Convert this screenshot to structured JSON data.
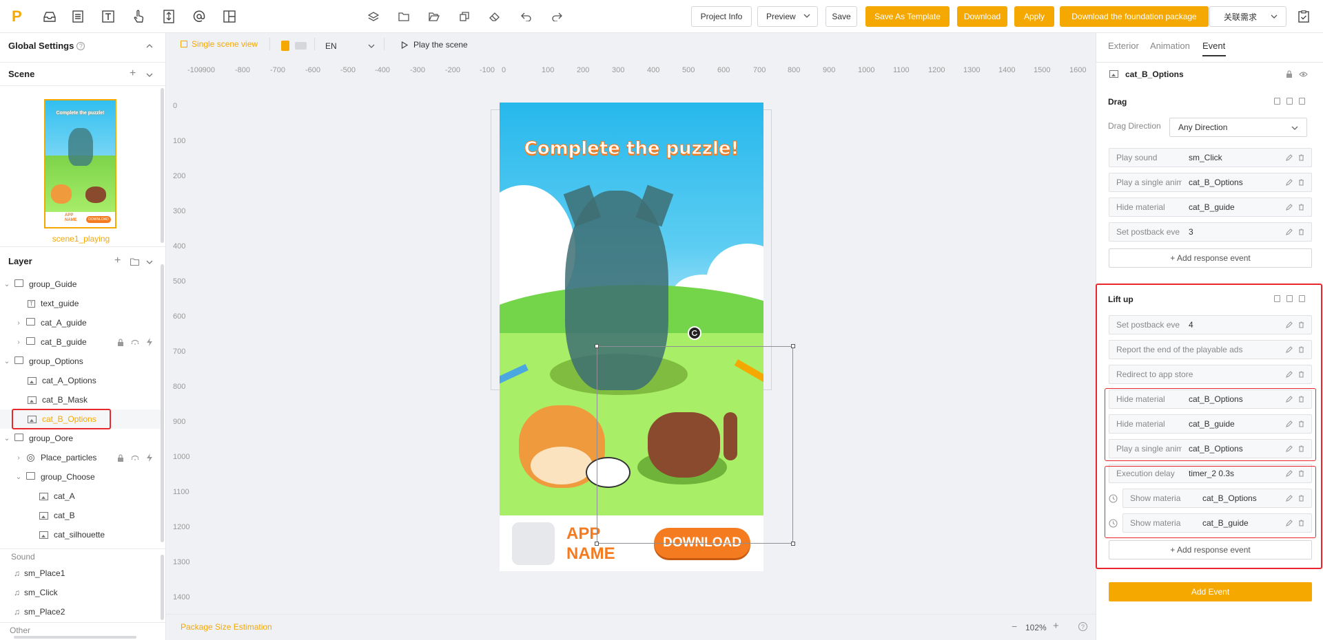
{
  "topbar": {
    "buttons": {
      "project_info": "Project Info",
      "preview": "Preview",
      "save": "Save",
      "save_as_template": "Save As Template",
      "download": "Download",
      "apply": "Apply",
      "download_foundation": "Download the foundation package",
      "related": "关联需求"
    }
  },
  "left": {
    "global_settings": "Global Settings",
    "scene_title": "Scene",
    "scene_name": "scene1_playing",
    "thumb_title": "Complete the puzzle!",
    "thumb_app": "APP NAME",
    "thumb_download": "DOWNLOAD",
    "layer_title": "Layer",
    "layers": [
      {
        "label": "group_Guide"
      },
      {
        "label": "text_guide"
      },
      {
        "label": "cat_A_guide"
      },
      {
        "label": "cat_B_guide"
      },
      {
        "label": "group_Options"
      },
      {
        "label": "cat_A_Options"
      },
      {
        "label": "cat_B_Mask"
      },
      {
        "label": "cat_B_Options"
      },
      {
        "label": "group_Oore"
      },
      {
        "label": "Place_particles"
      },
      {
        "label": "group_Choose"
      },
      {
        "label": "cat_A"
      },
      {
        "label": "cat_B"
      },
      {
        "label": "cat_silhouette"
      }
    ],
    "sound_title": "Sound",
    "sounds": [
      "sm_Place1",
      "sm_Click",
      "sm_Place2"
    ],
    "other_title": "Other"
  },
  "canvas_toolbar": {
    "single_scene": "Single scene view",
    "lang": "EN",
    "play": "Play the scene"
  },
  "ruler": {
    "h": [
      "-100",
      "-900",
      "-800",
      "-700",
      "-600",
      "-500",
      "-400",
      "-300",
      "-200",
      "-100",
      "0",
      "100",
      "200",
      "300",
      "400",
      "500",
      "600",
      "700",
      "800",
      "900",
      "1000",
      "1100",
      "1200",
      "1300",
      "1400",
      "1500",
      "1600"
    ],
    "v": [
      "0",
      "100",
      "200",
      "300",
      "400",
      "500",
      "600",
      "700",
      "800",
      "900",
      "1000",
      "1100",
      "1200",
      "1300",
      "1400"
    ]
  },
  "scene": {
    "title": "Complete the puzzle!",
    "app_line1": "APP",
    "app_line2": "NAME",
    "download": "DOWNLOAD"
  },
  "bottom": {
    "package": "Package Size Estimation",
    "zoom": "102%"
  },
  "right": {
    "tabs": [
      "Exterior",
      "Animation",
      "Event"
    ],
    "object_name": "cat_B_Options",
    "drag": {
      "title": "Drag",
      "direction_label": "Drag Direction",
      "direction_value": "Any Direction",
      "rows": [
        {
          "k": "Play sound",
          "v": "sm_Click"
        },
        {
          "k": "Play a single animati",
          "v": "cat_B_Options"
        },
        {
          "k": "Hide material",
          "v": "cat_B_guide"
        },
        {
          "k": "Set postback eve",
          "v": "3"
        }
      ],
      "add": "+ Add response event"
    },
    "lift": {
      "title": "Lift up",
      "rows": [
        {
          "k": "Set postback eve",
          "v": "4"
        },
        {
          "k": "Report the end of the playable ads",
          "v": ""
        },
        {
          "k": "Redirect to app store",
          "v": ""
        },
        {
          "k": "Hide material",
          "v": "cat_B_Options"
        },
        {
          "k": "Hide material",
          "v": "cat_B_guide"
        },
        {
          "k": "Play a single animati",
          "v": "cat_B_Options"
        },
        {
          "k": "Execution delay",
          "v": "timer_2 0.3s"
        },
        {
          "k": "Show materia",
          "v": "cat_B_Options"
        },
        {
          "k": "Show materia",
          "v": "cat_B_guide"
        }
      ],
      "add": "+ Add response event"
    },
    "add_event": "Add Event"
  },
  "colors": {
    "accent": "#f5a800",
    "highlight": "#e8262b"
  }
}
